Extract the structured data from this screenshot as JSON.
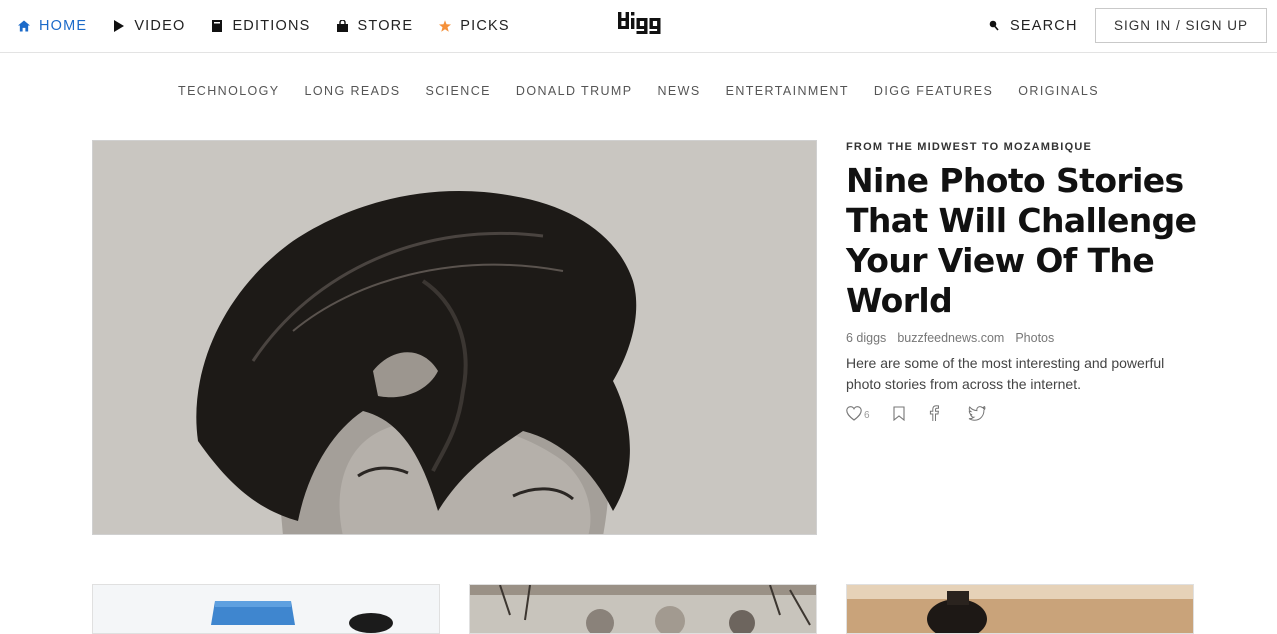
{
  "header": {
    "nav": [
      {
        "label": "HOME",
        "icon": "home-icon",
        "active": true
      },
      {
        "label": "VIDEO",
        "icon": "play-icon"
      },
      {
        "label": "EDITIONS",
        "icon": "editions-icon"
      },
      {
        "label": "STORE",
        "icon": "shopping-bag-icon"
      },
      {
        "label": "PICKS",
        "icon": "star-icon"
      }
    ],
    "logo": "digg",
    "search_label": "SEARCH",
    "signin_label": "SIGN IN / SIGN UP"
  },
  "subnav": [
    "TECHNOLOGY",
    "LONG READS",
    "SCIENCE",
    "DONALD TRUMP",
    "NEWS",
    "ENTERTAINMENT",
    "DIGG FEATURES",
    "ORIGINALS"
  ],
  "featured": {
    "kicker": "FROM THE MIDWEST TO MOZAMBIQUE",
    "headline": "Nine Photo Stories That Will Challenge Your View Of The World",
    "diggs": "6 diggs",
    "source": "buzzfeednews.com",
    "category": "Photos",
    "description": "Here are some of the most interesting and powerful photo stories from across the internet.",
    "digg_count": "6"
  },
  "colors": {
    "accent": "#1b6ac9",
    "star": "#f5913a",
    "text": "#222222"
  }
}
